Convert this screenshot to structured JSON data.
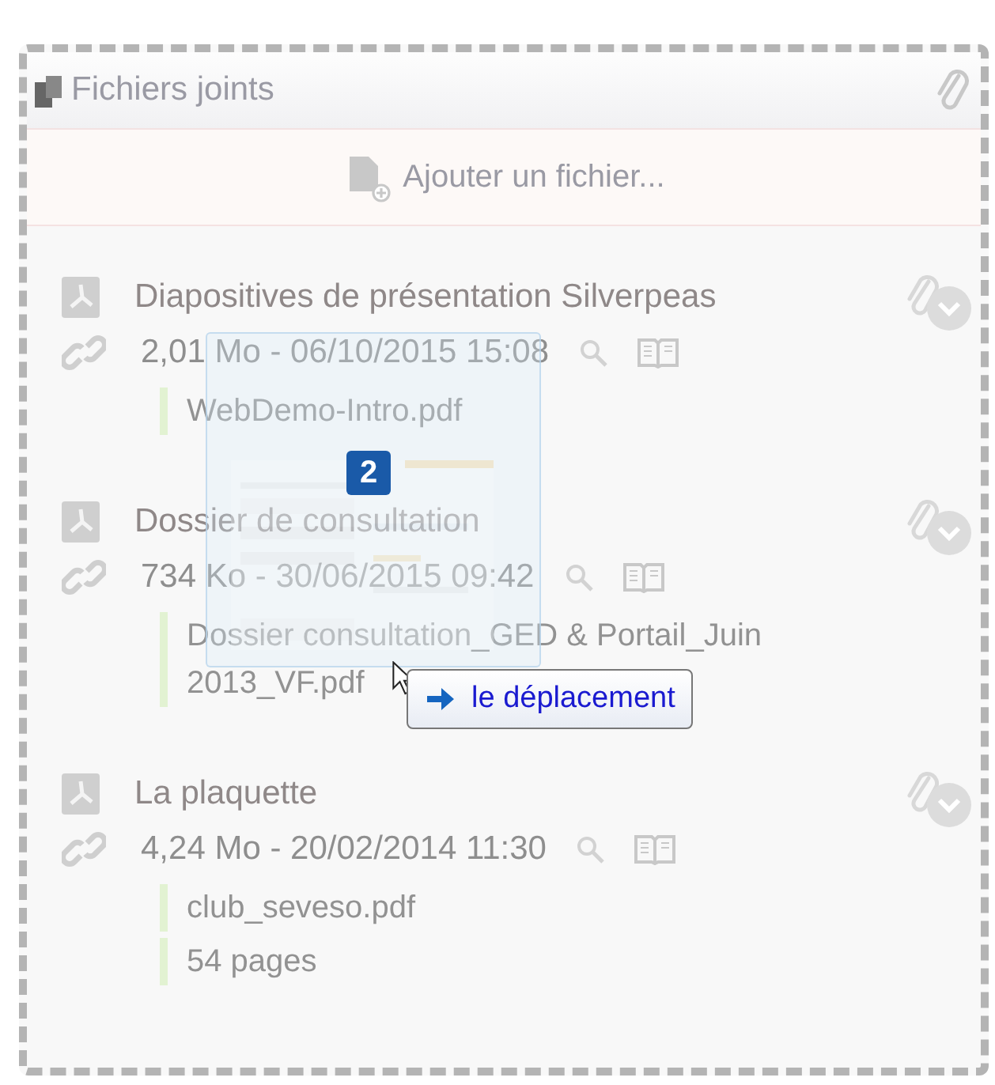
{
  "panel": {
    "title": "Fichiers joints",
    "add_label": "Ajouter un fichier..."
  },
  "files": [
    {
      "title": "Diapositives de présentation Silverpeas",
      "info": "2,01 Mo - 06/10/2015 15:08",
      "details": [
        "WebDemo-Intro.pdf"
      ]
    },
    {
      "title": "Dossier de consultation",
      "info": "734 Ko - 30/06/2015 09:42",
      "details": [
        "Dossier consultation_GED & Portail_Juin 2013_VF.pdf"
      ]
    },
    {
      "title": "La plaquette",
      "info": "4,24 Mo - 20/02/2014 11:30",
      "details": [
        "club_seveso.pdf",
        "54 pages"
      ]
    }
  ],
  "drag": {
    "count": "2",
    "action": "le déplacement"
  }
}
